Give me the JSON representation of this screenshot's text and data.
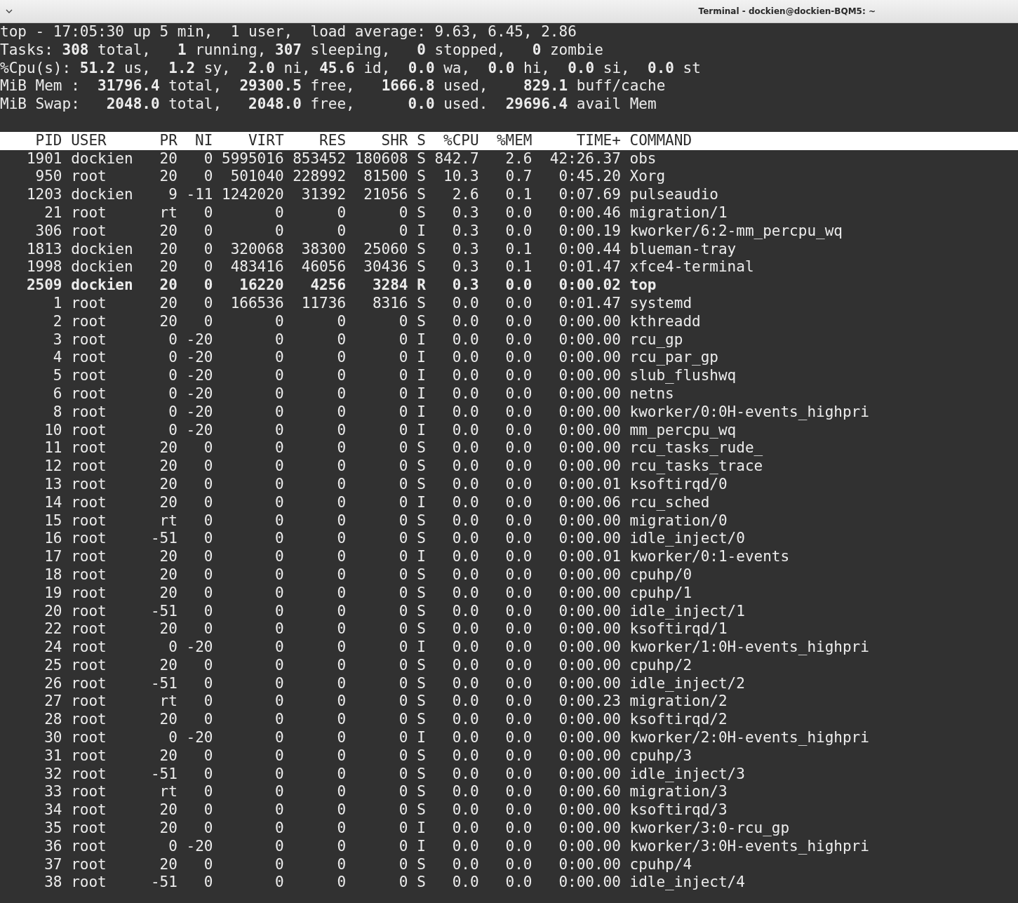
{
  "window": {
    "title": "Terminal - dockien@dockien-BQM5: ~"
  },
  "summary": [
    "top - 17:05:30 up 5 min,  1 user,  load average: 9.63, 6.45, 2.86",
    "Tasks: **308** total,   **1** running, **307** sleeping,   **0** stopped,   **0** zombie",
    "%Cpu(s): **51.2** us,  **1.2** sy,  **2.0** ni, **45.6** id,  **0.0** wa,  **0.0** hi,  **0.0** si,  **0.0** st",
    "MiB Mem :  **31796.4** total,  **29300.5** free,   **1666.8** used,    **829.1** buff/cache",
    "MiB Swap:   **2048.0** total,   **2048.0** free,      **0.0** used.  **29696.4** avail Mem"
  ],
  "table": {
    "columns": [
      "PID",
      "USER",
      "PR",
      "NI",
      "VIRT",
      "RES",
      "SHR",
      "S",
      "%CPU",
      "%MEM",
      "TIME+",
      "COMMAND"
    ],
    "rows": [
      {
        "cells": [
          "1901",
          "dockien",
          "20",
          "0",
          "5995016",
          "853452",
          "180608",
          "S",
          "842.7",
          "2.6",
          "42:26.37",
          "obs"
        ],
        "highlighted": false
      },
      {
        "cells": [
          "950",
          "root",
          "20",
          "0",
          "501040",
          "228992",
          "81500",
          "S",
          "10.3",
          "0.7",
          "0:45.20",
          "Xorg"
        ],
        "highlighted": false
      },
      {
        "cells": [
          "1203",
          "dockien",
          "9",
          "-11",
          "1242020",
          "31392",
          "21056",
          "S",
          "2.6",
          "0.1",
          "0:07.69",
          "pulseaudio"
        ],
        "highlighted": false
      },
      {
        "cells": [
          "21",
          "root",
          "rt",
          "0",
          "0",
          "0",
          "0",
          "S",
          "0.3",
          "0.0",
          "0:00.46",
          "migration/1"
        ],
        "highlighted": false
      },
      {
        "cells": [
          "306",
          "root",
          "20",
          "0",
          "0",
          "0",
          "0",
          "I",
          "0.3",
          "0.0",
          "0:00.19",
          "kworker/6:2-mm_percpu_wq"
        ],
        "highlighted": false
      },
      {
        "cells": [
          "1813",
          "dockien",
          "20",
          "0",
          "320068",
          "38300",
          "25060",
          "S",
          "0.3",
          "0.1",
          "0:00.44",
          "blueman-tray"
        ],
        "highlighted": false
      },
      {
        "cells": [
          "1998",
          "dockien",
          "20",
          "0",
          "483416",
          "46056",
          "30436",
          "S",
          "0.3",
          "0.1",
          "0:01.47",
          "xfce4-terminal"
        ],
        "highlighted": false
      },
      {
        "cells": [
          "2509",
          "dockien",
          "20",
          "0",
          "16220",
          "4256",
          "3284",
          "R",
          "0.3",
          "0.0",
          "0:00.02",
          "top"
        ],
        "highlighted": true
      },
      {
        "cells": [
          "1",
          "root",
          "20",
          "0",
          "166536",
          "11736",
          "8316",
          "S",
          "0.0",
          "0.0",
          "0:01.47",
          "systemd"
        ],
        "highlighted": false
      },
      {
        "cells": [
          "2",
          "root",
          "20",
          "0",
          "0",
          "0",
          "0",
          "S",
          "0.0",
          "0.0",
          "0:00.00",
          "kthreadd"
        ],
        "highlighted": false
      },
      {
        "cells": [
          "3",
          "root",
          "0",
          "-20",
          "0",
          "0",
          "0",
          "I",
          "0.0",
          "0.0",
          "0:00.00",
          "rcu_gp"
        ],
        "highlighted": false
      },
      {
        "cells": [
          "4",
          "root",
          "0",
          "-20",
          "0",
          "0",
          "0",
          "I",
          "0.0",
          "0.0",
          "0:00.00",
          "rcu_par_gp"
        ],
        "highlighted": false
      },
      {
        "cells": [
          "5",
          "root",
          "0",
          "-20",
          "0",
          "0",
          "0",
          "I",
          "0.0",
          "0.0",
          "0:00.00",
          "slub_flushwq"
        ],
        "highlighted": false
      },
      {
        "cells": [
          "6",
          "root",
          "0",
          "-20",
          "0",
          "0",
          "0",
          "I",
          "0.0",
          "0.0",
          "0:00.00",
          "netns"
        ],
        "highlighted": false
      },
      {
        "cells": [
          "8",
          "root",
          "0",
          "-20",
          "0",
          "0",
          "0",
          "I",
          "0.0",
          "0.0",
          "0:00.00",
          "kworker/0:0H-events_highpri"
        ],
        "highlighted": false
      },
      {
        "cells": [
          "10",
          "root",
          "0",
          "-20",
          "0",
          "0",
          "0",
          "I",
          "0.0",
          "0.0",
          "0:00.00",
          "mm_percpu_wq"
        ],
        "highlighted": false
      },
      {
        "cells": [
          "11",
          "root",
          "20",
          "0",
          "0",
          "0",
          "0",
          "S",
          "0.0",
          "0.0",
          "0:00.00",
          "rcu_tasks_rude_"
        ],
        "highlighted": false
      },
      {
        "cells": [
          "12",
          "root",
          "20",
          "0",
          "0",
          "0",
          "0",
          "S",
          "0.0",
          "0.0",
          "0:00.00",
          "rcu_tasks_trace"
        ],
        "highlighted": false
      },
      {
        "cells": [
          "13",
          "root",
          "20",
          "0",
          "0",
          "0",
          "0",
          "S",
          "0.0",
          "0.0",
          "0:00.01",
          "ksoftirqd/0"
        ],
        "highlighted": false
      },
      {
        "cells": [
          "14",
          "root",
          "20",
          "0",
          "0",
          "0",
          "0",
          "I",
          "0.0",
          "0.0",
          "0:00.06",
          "rcu_sched"
        ],
        "highlighted": false
      },
      {
        "cells": [
          "15",
          "root",
          "rt",
          "0",
          "0",
          "0",
          "0",
          "S",
          "0.0",
          "0.0",
          "0:00.00",
          "migration/0"
        ],
        "highlighted": false
      },
      {
        "cells": [
          "16",
          "root",
          "-51",
          "0",
          "0",
          "0",
          "0",
          "S",
          "0.0",
          "0.0",
          "0:00.00",
          "idle_inject/0"
        ],
        "highlighted": false
      },
      {
        "cells": [
          "17",
          "root",
          "20",
          "0",
          "0",
          "0",
          "0",
          "I",
          "0.0",
          "0.0",
          "0:00.01",
          "kworker/0:1-events"
        ],
        "highlighted": false
      },
      {
        "cells": [
          "18",
          "root",
          "20",
          "0",
          "0",
          "0",
          "0",
          "S",
          "0.0",
          "0.0",
          "0:00.00",
          "cpuhp/0"
        ],
        "highlighted": false
      },
      {
        "cells": [
          "19",
          "root",
          "20",
          "0",
          "0",
          "0",
          "0",
          "S",
          "0.0",
          "0.0",
          "0:00.00",
          "cpuhp/1"
        ],
        "highlighted": false
      },
      {
        "cells": [
          "20",
          "root",
          "-51",
          "0",
          "0",
          "0",
          "0",
          "S",
          "0.0",
          "0.0",
          "0:00.00",
          "idle_inject/1"
        ],
        "highlighted": false
      },
      {
        "cells": [
          "22",
          "root",
          "20",
          "0",
          "0",
          "0",
          "0",
          "S",
          "0.0",
          "0.0",
          "0:00.00",
          "ksoftirqd/1"
        ],
        "highlighted": false
      },
      {
        "cells": [
          "24",
          "root",
          "0",
          "-20",
          "0",
          "0",
          "0",
          "I",
          "0.0",
          "0.0",
          "0:00.00",
          "kworker/1:0H-events_highpri"
        ],
        "highlighted": false
      },
      {
        "cells": [
          "25",
          "root",
          "20",
          "0",
          "0",
          "0",
          "0",
          "S",
          "0.0",
          "0.0",
          "0:00.00",
          "cpuhp/2"
        ],
        "highlighted": false
      },
      {
        "cells": [
          "26",
          "root",
          "-51",
          "0",
          "0",
          "0",
          "0",
          "S",
          "0.0",
          "0.0",
          "0:00.00",
          "idle_inject/2"
        ],
        "highlighted": false
      },
      {
        "cells": [
          "27",
          "root",
          "rt",
          "0",
          "0",
          "0",
          "0",
          "S",
          "0.0",
          "0.0",
          "0:00.23",
          "migration/2"
        ],
        "highlighted": false
      },
      {
        "cells": [
          "28",
          "root",
          "20",
          "0",
          "0",
          "0",
          "0",
          "S",
          "0.0",
          "0.0",
          "0:00.00",
          "ksoftirqd/2"
        ],
        "highlighted": false
      },
      {
        "cells": [
          "30",
          "root",
          "0",
          "-20",
          "0",
          "0",
          "0",
          "I",
          "0.0",
          "0.0",
          "0:00.00",
          "kworker/2:0H-events_highpri"
        ],
        "highlighted": false
      },
      {
        "cells": [
          "31",
          "root",
          "20",
          "0",
          "0",
          "0",
          "0",
          "S",
          "0.0",
          "0.0",
          "0:00.00",
          "cpuhp/3"
        ],
        "highlighted": false
      },
      {
        "cells": [
          "32",
          "root",
          "-51",
          "0",
          "0",
          "0",
          "0",
          "S",
          "0.0",
          "0.0",
          "0:00.00",
          "idle_inject/3"
        ],
        "highlighted": false
      },
      {
        "cells": [
          "33",
          "root",
          "rt",
          "0",
          "0",
          "0",
          "0",
          "S",
          "0.0",
          "0.0",
          "0:00.60",
          "migration/3"
        ],
        "highlighted": false
      },
      {
        "cells": [
          "34",
          "root",
          "20",
          "0",
          "0",
          "0",
          "0",
          "S",
          "0.0",
          "0.0",
          "0:00.00",
          "ksoftirqd/3"
        ],
        "highlighted": false
      },
      {
        "cells": [
          "35",
          "root",
          "20",
          "0",
          "0",
          "0",
          "0",
          "I",
          "0.0",
          "0.0",
          "0:00.00",
          "kworker/3:0-rcu_gp"
        ],
        "highlighted": false
      },
      {
        "cells": [
          "36",
          "root",
          "0",
          "-20",
          "0",
          "0",
          "0",
          "I",
          "0.0",
          "0.0",
          "0:00.00",
          "kworker/3:0H-events_highpri"
        ],
        "highlighted": false
      },
      {
        "cells": [
          "37",
          "root",
          "20",
          "0",
          "0",
          "0",
          "0",
          "S",
          "0.0",
          "0.0",
          "0:00.00",
          "cpuhp/4"
        ],
        "highlighted": false
      },
      {
        "cells": [
          "38",
          "root",
          "-51",
          "0",
          "0",
          "0",
          "0",
          "S",
          "0.0",
          "0.0",
          "0:00.00",
          "idle_inject/4"
        ],
        "highlighted": false
      }
    ]
  }
}
